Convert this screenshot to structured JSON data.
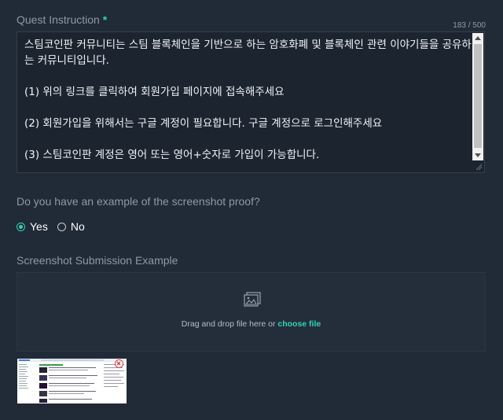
{
  "quest_instruction": {
    "label": "Quest Instruction",
    "required_mark": "*",
    "counter": "183 / 500",
    "text": "스팀코인판 커뮤니티는 스팀 블록체인을 기반으로 하는 암호화폐 및 블록체인 관련 이야기들을 공유하는 커뮤니티입니다.\n\n(1) 위의 링크를 클릭하여 회원가입 페이지에 접속해주세요\n\n(2) 회원가입을 위해서는 구글 계정이 필요합니다. 구글 계정으로 로그인해주세요\n\n(3) 스팀코인판 계정은 영어 또는 영어+숫자로 가입이 가능합니다."
  },
  "proof_question": {
    "label": "Do you have an example of the screenshot proof?",
    "options": [
      {
        "label": "Yes",
        "checked": true
      },
      {
        "label": "No",
        "checked": false
      }
    ]
  },
  "screenshot_example": {
    "label": "Screenshot Submission Example",
    "drop_text": "Drag and drop file here or ",
    "choose_file": "choose file",
    "icon": "image-icon",
    "remove_icon": "remove-icon"
  },
  "colors": {
    "background": "#212a37",
    "accent": "#2fd4b6",
    "remove": "#e03a3a"
  }
}
